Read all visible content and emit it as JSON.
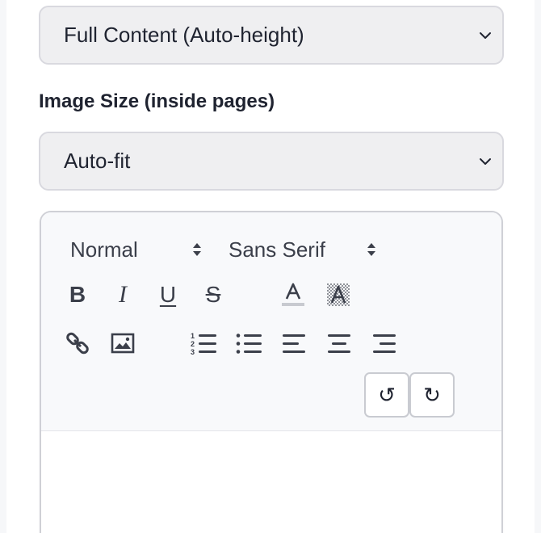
{
  "layout_select": {
    "value": "Full Content (Auto-height)"
  },
  "image_size": {
    "label": "Image Size (inside pages)",
    "value": "Auto-fit"
  },
  "editor": {
    "header_picker": "Normal",
    "font_picker": "Sans Serif",
    "format_buttons": {
      "bold": "B",
      "italic": "I",
      "underline": "U",
      "strike": "S"
    },
    "undo_icon": "↺",
    "redo_icon": "↻",
    "content": ""
  },
  "colors": {
    "select_bg": "#efeff1",
    "toolbar_bg": "#f8f9fb",
    "icon": "#3b3f4a",
    "text": "#1f2330"
  }
}
